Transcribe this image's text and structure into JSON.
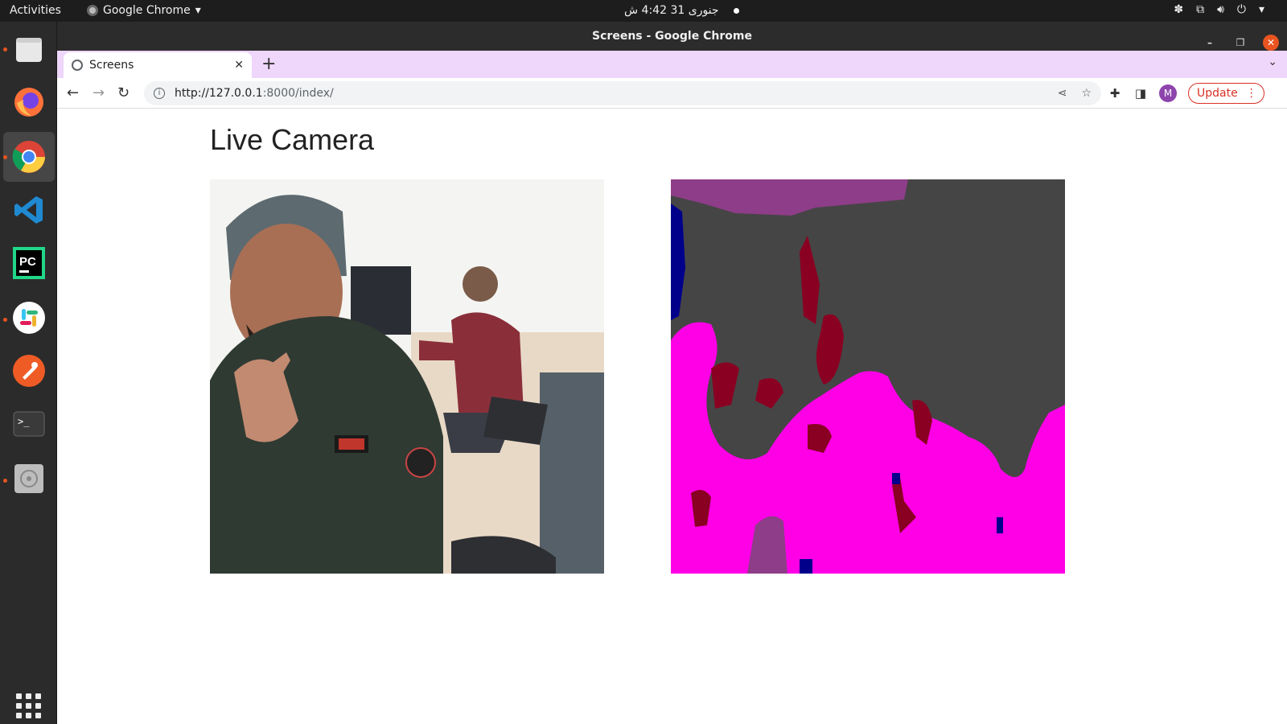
{
  "topbar": {
    "activities": "Activities",
    "app_name": "Google Chrome",
    "clock": "جنوری 31  4:42 ش"
  },
  "window": {
    "title": "Screens - Google Chrome"
  },
  "tab": {
    "title": "Screens"
  },
  "omnibox": {
    "url_host": "http://127.0.0.1",
    "url_path": ":8000/index/"
  },
  "toolbar": {
    "avatar_letter": "M",
    "update_label": "Update"
  },
  "page": {
    "heading": "Live Camera"
  },
  "colors": {
    "accent": "#e95420",
    "tabstrip": "#efd6fb",
    "segment_magenta": "#ff00e6",
    "segment_gray": "#454545",
    "segment_crimson": "#8a0022",
    "segment_purple": "#8e3d88",
    "segment_blue": "#00008b"
  }
}
